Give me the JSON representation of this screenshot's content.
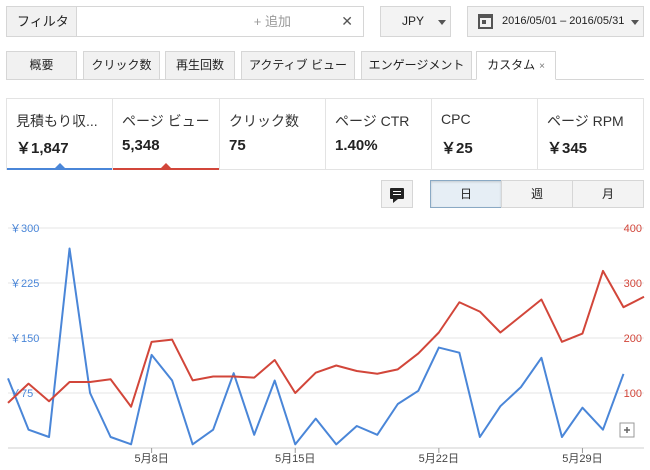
{
  "filter": {
    "label": "フィルタ",
    "add_label": "+ 追加",
    "clear_icon": "✕"
  },
  "currency": {
    "label": "JPY"
  },
  "date_range": {
    "label": "2016/05/01 – 2016/05/31"
  },
  "tabs": [
    {
      "label": "概要"
    },
    {
      "label": "クリック数"
    },
    {
      "label": "再生回数"
    },
    {
      "label": "アクティブ ビュー"
    },
    {
      "label": "エンゲージメント"
    },
    {
      "label": "カスタム",
      "active": true,
      "close": "×"
    }
  ],
  "metrics": [
    {
      "name": "見積もり収...",
      "value": "￥1,847",
      "color": "#4a86d8"
    },
    {
      "name": "ページ ビュー",
      "value": "5,348",
      "color": "#d2463a"
    },
    {
      "name": "クリック数",
      "value": "75"
    },
    {
      "name": "ページ CTR",
      "value": "1.40%"
    },
    {
      "name": "CPC",
      "value": "￥25"
    },
    {
      "name": "ページ RPM",
      "value": "￥345"
    }
  ],
  "period": {
    "day": "日",
    "week": "週",
    "month": "月",
    "active": "day"
  },
  "chart_data": {
    "type": "line",
    "x_start_day": 1,
    "x_ticks": [
      "5月8日",
      "5月15日",
      "5月22日",
      "5月29日"
    ],
    "y_left": {
      "ticks": [
        "￥300",
        "￥225",
        "￥150",
        "￥75"
      ],
      "values": [
        300,
        225,
        150,
        75
      ],
      "ylim": [
        0,
        300
      ]
    },
    "y_right": {
      "ticks": [
        "400",
        "300",
        "200",
        "100"
      ],
      "values": [
        400,
        300,
        200,
        100
      ],
      "ylim": [
        0,
        400
      ]
    },
    "series": [
      {
        "name": "見積もり収益",
        "axis": "left",
        "color": "#4a86d8",
        "values": [
          95,
          25,
          15,
          272,
          75,
          15,
          5,
          127,
          92,
          5,
          25,
          102,
          18,
          92,
          5,
          40,
          5,
          30,
          18,
          60,
          78,
          137,
          130,
          15,
          57,
          83,
          123,
          15,
          55,
          25,
          101
        ]
      },
      {
        "name": "ページ ビュー",
        "axis": "right",
        "color": "#d2463a",
        "values": [
          82,
          117,
          85,
          120,
          120,
          125,
          75,
          193,
          197,
          123,
          130,
          130,
          128,
          160,
          100,
          137,
          150,
          140,
          135,
          143,
          172,
          210,
          265,
          248,
          210,
          240,
          270,
          193,
          208,
          322,
          256,
          275
        ]
      }
    ]
  }
}
